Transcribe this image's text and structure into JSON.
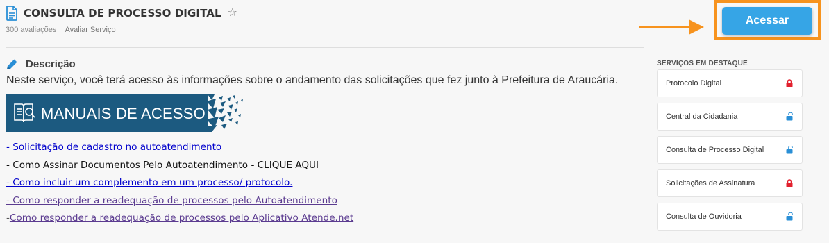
{
  "header": {
    "title": "CONSULTA DE PROCESSO DIGITAL",
    "ratings": "300 avaliações",
    "rate_link": "Avaliar Serviço",
    "access_button": "Acessar"
  },
  "description": {
    "heading": "Descrição",
    "text": "Neste serviço, você terá acesso às informações sobre o andamento das solicitações que fez junto à Prefeitura de Araucária.",
    "banner_text": "MANUAIS DE ACESSO"
  },
  "links": [
    {
      "prefix": "",
      "text": "- Solicitação de cadastro no autoatendimento",
      "color": "blue"
    },
    {
      "prefix": "",
      "text": "- Como Assinar Documentos Pelo Autoatendimento - CLIQUE AQUI",
      "color": "black"
    },
    {
      "prefix": "",
      "text": "- Como incluir um complemento em um processo/ protocolo.",
      "color": "blue"
    },
    {
      "prefix": "",
      "text": "- Como responder a readequação de processos pelo Autoatendimento",
      "color": "purple"
    },
    {
      "prefix": "- ",
      "text": "Como responder a readequação de processos pelo Aplicativo Atende.net",
      "color": "purple"
    }
  ],
  "featured": {
    "title": "SERVIÇOS EM DESTAQUE",
    "items": [
      {
        "label": "Protocolo Digital",
        "lock": "locked"
      },
      {
        "label": "Central da Cidadania",
        "lock": "unlocked"
      },
      {
        "label": "Consulta de Processo Digital",
        "lock": "unlocked"
      },
      {
        "label": "Solicitações de Assinatura",
        "lock": "locked"
      },
      {
        "label": "Consulta de Ouvidoria",
        "lock": "unlocked"
      }
    ]
  },
  "colors": {
    "accent_blue": "#36a5e6",
    "highlight_orange": "#f7931e",
    "banner_navy": "#1c5a80",
    "lock_red": "#e2202e",
    "lock_blue": "#2a8fd6"
  }
}
